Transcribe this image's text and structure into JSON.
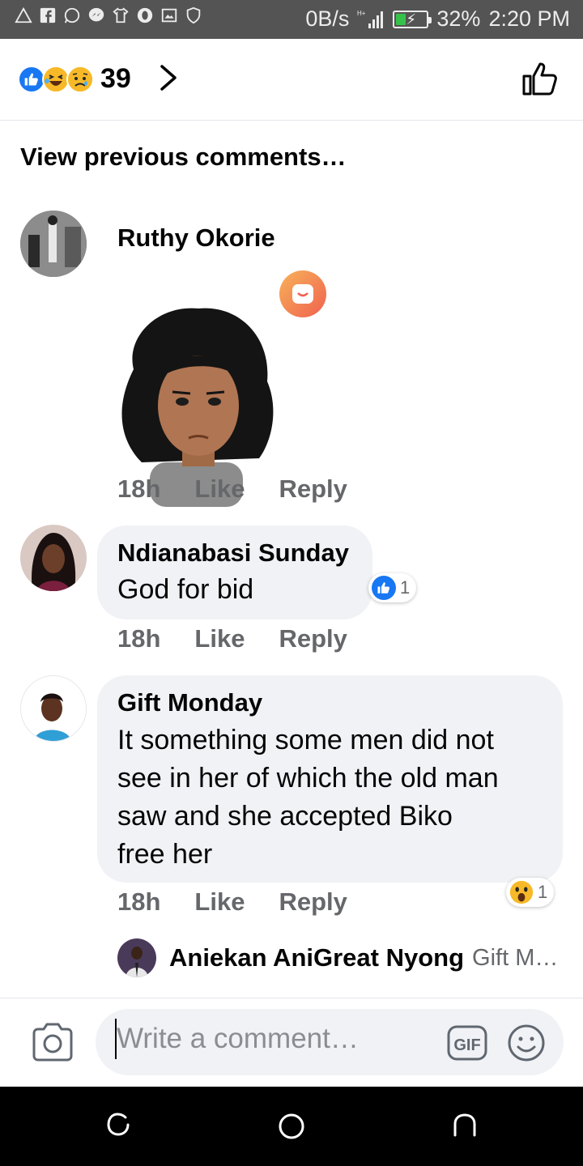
{
  "status_bar": {
    "speed": "0B/s",
    "battery_percent": "32%",
    "battery_level": 0.32,
    "time": "2:20 PM",
    "notification_icons": [
      "warning-icon",
      "facebook-icon",
      "whatsapp-icon",
      "messenger-icon",
      "shirt-icon",
      "opera-icon",
      "image-icon",
      "shield-icon"
    ]
  },
  "header": {
    "reaction_icons": [
      "like-reaction-icon",
      "haha-reaction-icon",
      "sad-reaction-icon"
    ],
    "reaction_count": "39"
  },
  "view_previous": "View previous comments…",
  "comments": [
    {
      "name": "Ruthy Okorie",
      "sticker": "avatar-sticker",
      "time": "18h",
      "like": "Like",
      "reply": "Reply"
    },
    {
      "name": "Ndianabasi Sunday",
      "text": "God for bid",
      "reaction_count": "1",
      "time": "18h",
      "like": "Like",
      "reply": "Reply"
    },
    {
      "name": "Gift Monday",
      "text_lines": [
        "It something some men did not",
        "see in her of which the old man",
        "saw and she accepted Biko",
        "free her"
      ],
      "reaction_count": "1",
      "time": "18h",
      "like": "Like",
      "reply": "Reply"
    }
  ],
  "reply_preview": {
    "name": "Aniekan AniGreat Nyong",
    "text": "Gift M…"
  },
  "composer": {
    "placeholder": "Write a comment…"
  },
  "colors": {
    "facebook_blue": "#1877f2",
    "bubble_bg": "#f0f2f5",
    "meta_gray": "#65676b"
  }
}
